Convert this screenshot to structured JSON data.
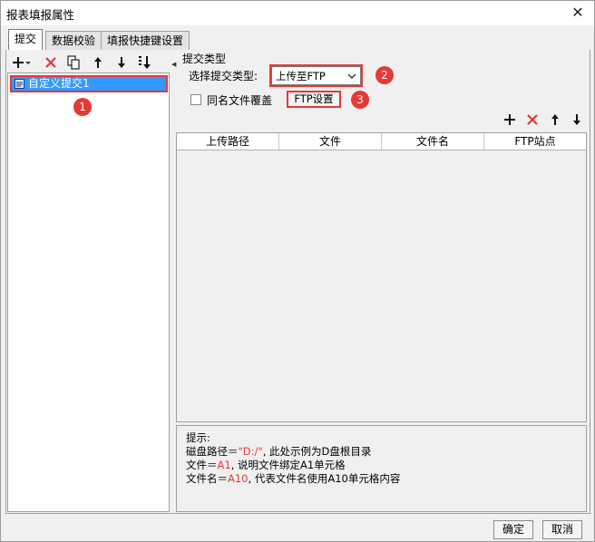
{
  "window": {
    "title": "报表填报属性",
    "close_glyph": "✕"
  },
  "tabs": [
    {
      "label": "提交",
      "active": true
    },
    {
      "label": "数据校验",
      "active": false
    },
    {
      "label": "填报快捷键设置",
      "active": false
    }
  ],
  "left_toolbar": {
    "icons": [
      "add-icon",
      "dropdown-icon",
      "delete-icon",
      "copy-icon",
      "move-up-icon",
      "move-down-icon",
      "move-bottom-icon"
    ]
  },
  "tree": {
    "items": [
      {
        "label": "自定义提交1",
        "selected": true
      }
    ]
  },
  "submit": {
    "group_title": "提交类型",
    "type_label": "选择提交类型:",
    "type_value": "上传至FTP",
    "overwrite_label": "同名文件覆盖",
    "overwrite_checked": false,
    "ftp_settings_label": "FTP设置"
  },
  "right_toolbar": {
    "icons": [
      "add-icon",
      "delete-icon",
      "move-up-icon",
      "move-down-icon"
    ]
  },
  "grid": {
    "columns": [
      "上传路径",
      "文件",
      "文件名",
      "FTP站点"
    ],
    "rows": []
  },
  "hint": {
    "title": "提示:",
    "line1_prefix": "磁盘路径＝",
    "line1_value": "\"D:/\"",
    "line1_suffix": ", 此处示例为D盘根目录",
    "line2_prefix": "文件＝",
    "line2_value": "A1",
    "line2_suffix": ", 说明文件绑定A1单元格",
    "line3_prefix": "文件名＝",
    "line3_value": "A10",
    "line3_suffix": ", 代表文件名使用A10单元格内容"
  },
  "annotations": [
    "1",
    "2",
    "3"
  ],
  "footer": {
    "ok_label": "确定",
    "cancel_label": "取消"
  },
  "colors": {
    "selection": "#3399ff",
    "annotation_red": "#e53935",
    "delete_red": "#e53935"
  }
}
